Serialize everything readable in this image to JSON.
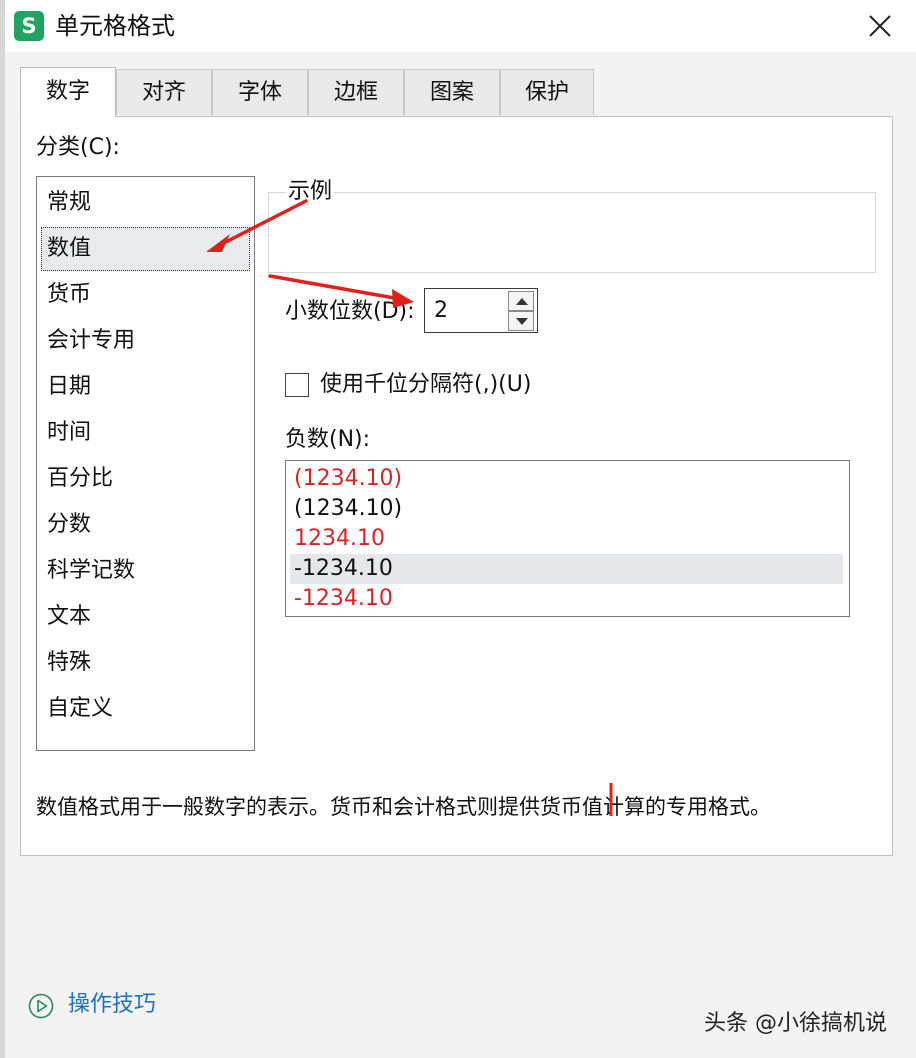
{
  "window": {
    "title": "单元格格式",
    "app_icon_letter": "S",
    "app_icon_color": "#21a462"
  },
  "tabs": [
    {
      "label": "数字",
      "active": true
    },
    {
      "label": "对齐",
      "active": false
    },
    {
      "label": "字体",
      "active": false
    },
    {
      "label": "边框",
      "active": false
    },
    {
      "label": "图案",
      "active": false
    },
    {
      "label": "保护",
      "active": false
    }
  ],
  "category": {
    "label": "分类(C):",
    "items": [
      "常规",
      "数值",
      "货币",
      "会计专用",
      "日期",
      "时间",
      "百分比",
      "分数",
      "科学记数",
      "文本",
      "特殊",
      "自定义"
    ],
    "selected": "数值"
  },
  "sample": {
    "label": "示例"
  },
  "decimal": {
    "label": "小数位数(D):",
    "value": "2"
  },
  "thousands_separator": {
    "label": "使用千位分隔符(,)(U)",
    "checked": false
  },
  "negative": {
    "label": "负数(N):",
    "items": [
      {
        "text": "(1234.10)",
        "color": "red"
      },
      {
        "text": "(1234.10)",
        "color": "black"
      },
      {
        "text": "1234.10",
        "color": "red"
      },
      {
        "text": "-1234.10",
        "color": "black",
        "selected": true
      },
      {
        "text": "-1234.10",
        "color": "red"
      }
    ]
  },
  "description": "数值格式用于一般数字的表示。货币和会计格式则提供货币值计算的专用格式。",
  "tips": {
    "label": "操作技巧",
    "icon": "play-circle-icon"
  },
  "watermark": "头条 @小徐搞机说",
  "colors": {
    "accent_link": "#1f6fc4",
    "negative_red": "#d0262a",
    "annotation_red": "#e0201c"
  }
}
